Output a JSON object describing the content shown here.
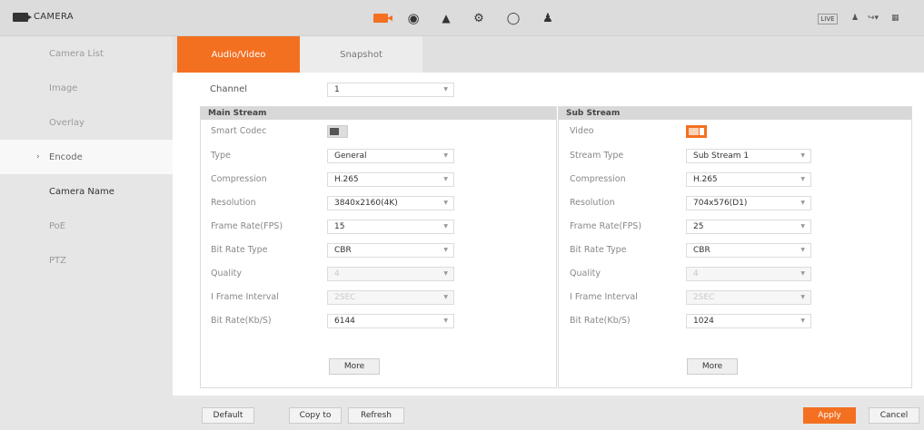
{
  "app": {
    "title": "CAMERA",
    "live_label": "LIVE"
  },
  "top_icons": [
    "camera-icon",
    "network-icon",
    "storage-icon",
    "settings-icon",
    "security-icon",
    "account-icon"
  ],
  "accent": "#f37021",
  "sidebar": {
    "items": [
      {
        "label": "Camera List"
      },
      {
        "label": "Image"
      },
      {
        "label": "Overlay"
      },
      {
        "label": "Encode"
      },
      {
        "label": "Camera Name"
      },
      {
        "label": "PoE"
      },
      {
        "label": "PTZ"
      }
    ]
  },
  "tabs": [
    {
      "label": "Audio/Video"
    },
    {
      "label": "Snapshot"
    }
  ],
  "channel": {
    "label": "Channel",
    "value": "1"
  },
  "main_stream": {
    "title": "Main Stream",
    "smart_codec_label": "Smart Codec",
    "smart_codec_on": false,
    "type_label": "Type",
    "type_value": "General",
    "compression_label": "Compression",
    "compression_value": "H.265",
    "resolution_label": "Resolution",
    "resolution_value": "3840x2160(4K)",
    "frame_rate_label": "Frame Rate(FPS)",
    "frame_rate_value": "15",
    "bit_rate_type_label": "Bit Rate Type",
    "bit_rate_type_value": "CBR",
    "quality_label": "Quality",
    "quality_value": "4",
    "iframe_label": "I Frame Interval",
    "iframe_value": "2SEC",
    "bit_rate_label": "Bit Rate(Kb/S)",
    "bit_rate_value": "6144",
    "more_label": "More"
  },
  "sub_stream": {
    "title": "Sub Stream",
    "video_label": "Video",
    "video_on": true,
    "stream_type_label": "Stream Type",
    "stream_type_value": "Sub Stream 1",
    "compression_label": "Compression",
    "compression_value": "H.265",
    "resolution_label": "Resolution",
    "resolution_value": "704x576(D1)",
    "frame_rate_label": "Frame Rate(FPS)",
    "frame_rate_value": "25",
    "bit_rate_type_label": "Bit Rate Type",
    "bit_rate_type_value": "CBR",
    "quality_label": "Quality",
    "quality_value": "4",
    "iframe_label": "I Frame Interval",
    "iframe_value": "2SEC",
    "bit_rate_label": "Bit Rate(Kb/S)",
    "bit_rate_value": "1024",
    "more_label": "More"
  },
  "footer": {
    "default_label": "Default",
    "copy_label": "Copy to",
    "refresh_label": "Refresh",
    "apply_label": "Apply",
    "cancel_label": "Cancel"
  }
}
